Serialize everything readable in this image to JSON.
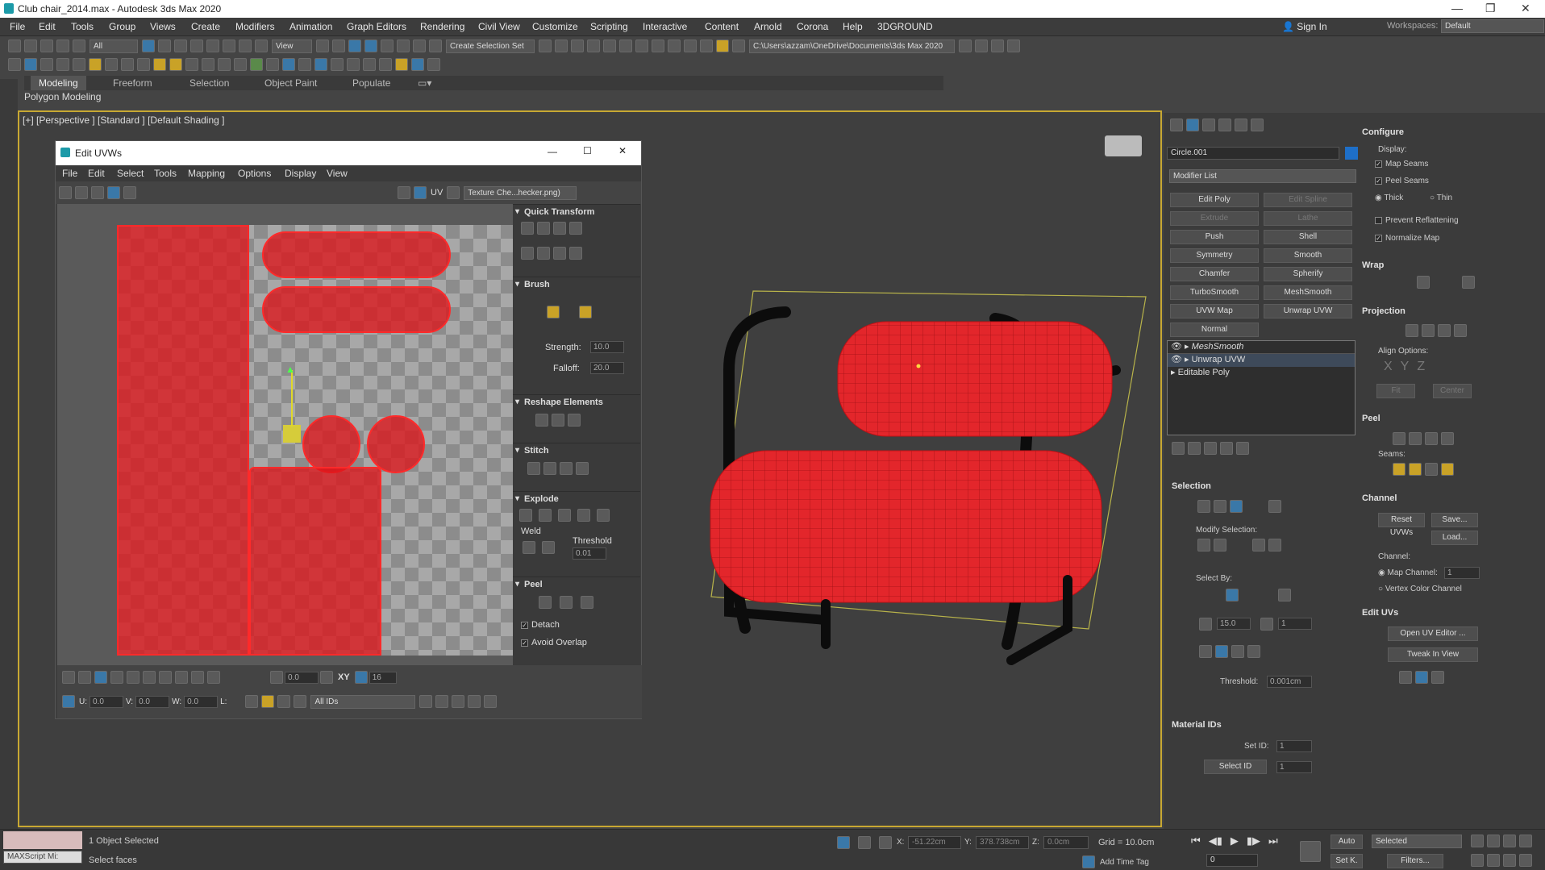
{
  "window": {
    "title": "Club chair_2014.max - Autodesk 3ds Max 2020",
    "min": "—",
    "max": "❐",
    "close": "✕"
  },
  "menu": [
    "File",
    "Edit",
    "Tools",
    "Group",
    "Views",
    "Create",
    "Modifiers",
    "Animation",
    "Graph Editors",
    "Rendering",
    "Civil View",
    "Customize",
    "Scripting",
    "Interactive",
    "Content",
    "Arnold",
    "Corona",
    "Help",
    "3DGROUND"
  ],
  "account": {
    "sign_in": "Sign In",
    "workspaces_label": "Workspaces:",
    "workspace": "Default"
  },
  "toolbar": {
    "filter": "All",
    "view": "View",
    "selection_set": "Create Selection Set",
    "path": "C:\\Users\\azzam\\OneDrive\\Documents\\3ds Max 2020"
  },
  "ribbon": {
    "tabs": [
      "Modeling",
      "Freeform",
      "Selection",
      "Object Paint",
      "Populate"
    ],
    "sub": "Polygon Modeling"
  },
  "viewport": {
    "label": "[+] [Perspective ] [Standard ] [Default Shading ]"
  },
  "uv": {
    "title": "Edit UVWs",
    "menus": [
      "File",
      "Edit",
      "Select",
      "Tools",
      "Mapping",
      "Options",
      "Display",
      "View"
    ],
    "uv_label": "UV",
    "texture": "Texture Che...hecker.png)",
    "sections": {
      "quick": "Quick Transform",
      "brush": "Brush",
      "reshape": "Reshape Elements",
      "stitch": "Stitch",
      "explode": "Explode",
      "peel": "Peel"
    },
    "strength_label": "Strength:",
    "strength": "10.0",
    "falloff_label": "Falloff:",
    "falloff": "20.0",
    "weld": "Weld",
    "threshold_label": "Threshold",
    "threshold": "0.01",
    "detach": "Detach",
    "avoid": "Avoid Overlap",
    "u_label": "U:",
    "u": "0.0",
    "v_label": "V:",
    "v": "0.0",
    "w_label": "W:",
    "w": "0.0",
    "l_label": "L:",
    "ids": "All IDs",
    "angle": "0.0",
    "xy": "XY",
    "grid": "16"
  },
  "panel": {
    "object": "Circle.001",
    "modlist": "Modifier List",
    "buttons": [
      "Edit Poly",
      "Edit Spline",
      "Extrude",
      "Lathe",
      "Push",
      "Shell",
      "Symmetry",
      "Smooth",
      "Chamfer",
      "Spherify",
      "TurboSmooth",
      "MeshSmooth",
      "UVW Map",
      "Unwrap UVW",
      "Normal"
    ],
    "stack": [
      "MeshSmooth",
      "Unwrap UVW",
      "Editable Poly"
    ],
    "selection": "Selection",
    "modify_sel": "Modify Selection:",
    "select_by": "Select By:",
    "angle": "15.0",
    "count": "1",
    "threshold_label": "Threshold:",
    "threshold": "0.001cm",
    "material_ids": "Material IDs",
    "set_id_label": "Set ID:",
    "set_id": "1",
    "select_id": "Select ID",
    "select_id_val": "1",
    "configure": "Configure",
    "display": "Display:",
    "map_seams": "Map Seams",
    "peel_seams": "Peel Seams",
    "thick": "Thick",
    "thin": "Thin",
    "prevent": "Prevent Reflattening",
    "normalize": "Normalize Map",
    "wrap": "Wrap",
    "projection": "Projection",
    "align": "Align Options:",
    "fit": "Fit",
    "center": "Center",
    "peel": "Peel",
    "seams": "Seams:",
    "channel": "Channel",
    "reset": "Reset UVWs",
    "save": "Save...",
    "load": "Load...",
    "channel_label": "Channel:",
    "map_channel": "Map Channel:",
    "map_channel_val": "1",
    "vertex_color": "Vertex Color Channel",
    "edit_uvs": "Edit UVs",
    "open_uv": "Open UV Editor ...",
    "tweak": "Tweak In View"
  },
  "status": {
    "maxscript": "MAXScript Mi:",
    "selected": "1 Object Selected",
    "hint": "Select faces",
    "x_label": "X:",
    "x": "-51.22cm",
    "y_label": "Y:",
    "y": "378.738cm",
    "z_label": "Z:",
    "z": "0.0cm",
    "grid": "Grid = 10.0cm",
    "add_time": "Add Time Tag",
    "auto": "Auto",
    "setk": "Set K.",
    "selected_dd": "Selected",
    "frame": "0",
    "filters": "Filters..."
  },
  "colors": {
    "accent": "#c8a832",
    "uvred": "#dd1a1f",
    "panelbg": "#3b3b3b"
  }
}
